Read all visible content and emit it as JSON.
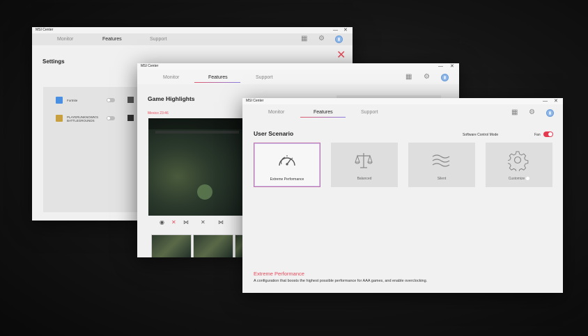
{
  "app_title": "MSI Center",
  "titlebar_controls": {
    "minimize": "—",
    "close": "✕"
  },
  "tabs": {
    "monitor": "Monitor",
    "features": "Features",
    "support": "Support"
  },
  "settings": {
    "title": "Settings",
    "games": [
      {
        "name": "Fortnite",
        "icon_color": "#4a90e2"
      },
      {
        "name": "PLAYERUNKNOWN'S\nBATTLEGROUNDS",
        "icon_color": "#c8a040"
      }
    ]
  },
  "game_highlights": {
    "title": "Game Highlights",
    "subtitle": "Mexico 23:46",
    "controls": [
      "◉",
      "✕",
      "⋈",
      "✕",
      "⋈"
    ]
  },
  "user_scenario": {
    "title": "User Scenario",
    "software_control_mode_label": "Software Control Mode",
    "fan_label": "Fan",
    "fan_enabled": true,
    "accent_color": "#e53950",
    "cards": [
      {
        "label": "Extreme Performance",
        "icon": "speedometer-icon",
        "selected": true
      },
      {
        "label": "Balanced",
        "icon": "balance-scale-icon",
        "selected": false
      },
      {
        "label": "Silent",
        "icon": "wind-waves-icon",
        "selected": false
      },
      {
        "label": "Customize",
        "icon": "gear-icon",
        "selected": false
      }
    ],
    "description_title": "Extreme Performance",
    "description_text": "A configuration that boosts the highest possible performance for AAA games, and enable overclocking."
  }
}
